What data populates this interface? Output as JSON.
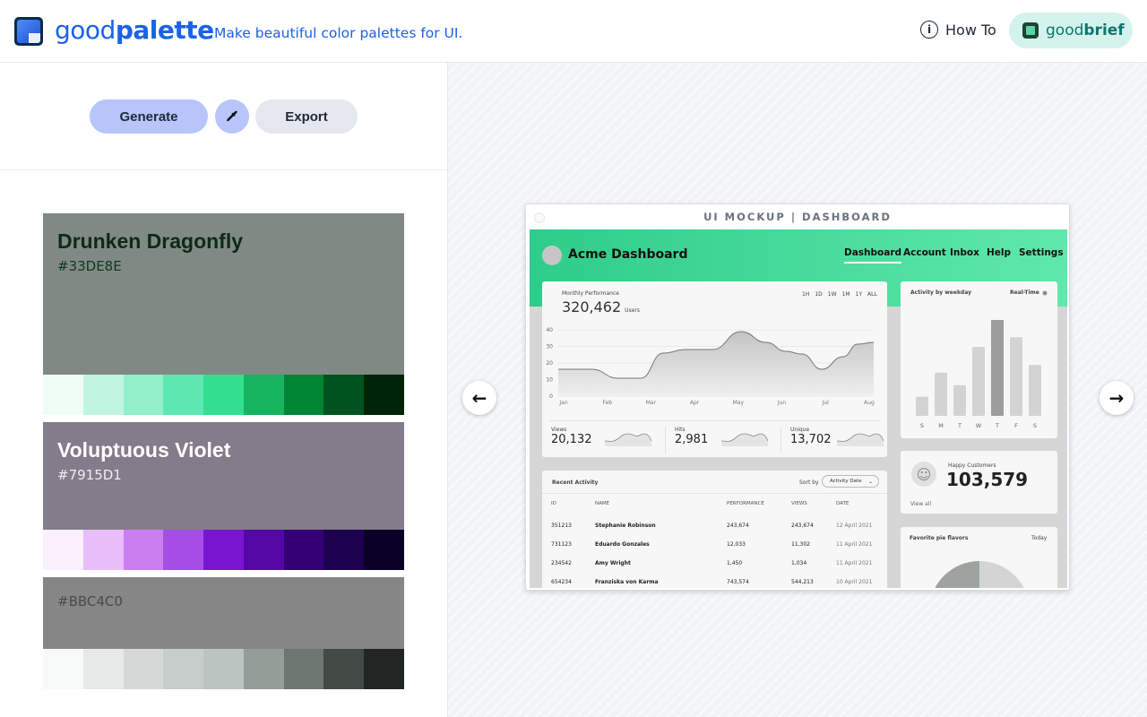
{
  "header": {
    "brand_light": "good",
    "brand_bold": "palette",
    "tagline": "Make beautiful color palettes for UI.",
    "howto_label": "How To",
    "howto_icon": "info-icon",
    "goodbrief_light": "good",
    "goodbrief_bold": "brief"
  },
  "toolbar": {
    "generate_label": "Generate",
    "picker_icon": "eyedropper-icon",
    "export_label": "Export"
  },
  "palettes": [
    {
      "name": "Drunken Dragonfly",
      "hex": "#33DE8E",
      "main_color": "#818984",
      "text_color": "#0d2a17",
      "swatches": [
        "#f0fdf7",
        "#c2f5e1",
        "#91efca",
        "#5ce8b0",
        "#33de8e",
        "#16b45f",
        "#008535",
        "#00531e",
        "#002408"
      ]
    },
    {
      "name": "Voluptuous Violet",
      "hex": "#7915D1",
      "main_color": "#847c8a",
      "text_color": "#ffffff",
      "swatches": [
        "#fbf0fe",
        "#e9bdf9",
        "#cb7ef0",
        "#a54ee6",
        "#7915d1",
        "#5507a5",
        "#340075",
        "#1d0050",
        "#0b0027"
      ]
    },
    {
      "name": "",
      "hex": "#BBC4C0",
      "main_color": "#868686",
      "text_color": "#4a4a4a",
      "swatches": [
        "#f8faf9",
        "#e5eae8",
        "#d4d9d7",
        "#c7cdca",
        "#bbc4c0",
        "#959d99",
        "#6e7672",
        "#434945",
        "#212523"
      ]
    }
  ],
  "preview": {
    "prev_icon": "arrow-left-icon",
    "next_icon": "arrow-right-icon",
    "title": "UI MOCKUP | DASHBOARD",
    "app_name": "Acme Dashboard",
    "nav": [
      "Dashboard",
      "Account",
      "Inbox",
      "Help",
      "Settings"
    ],
    "performance": {
      "label": "Monthly Performance",
      "value": "320,462",
      "unit": "Users",
      "ranges": [
        "1H",
        "1D",
        "1W",
        "1M",
        "1Y",
        "ALL"
      ],
      "y_ticks": [
        "40",
        "30",
        "20",
        "10",
        "0"
      ],
      "months": [
        "Jan",
        "Feb",
        "Mar",
        "Apr",
        "May",
        "Jun",
        "Jul",
        "Aug"
      ]
    },
    "stats": [
      {
        "label": "Views",
        "value": "20,132"
      },
      {
        "label": "Hits",
        "value": "2,981"
      },
      {
        "label": "Unique",
        "value": "13,702"
      }
    ],
    "weekday": {
      "title": "Activity by weekday",
      "mode": "Real-Time",
      "days": [
        "S",
        "M",
        "T",
        "W",
        "T",
        "F",
        "S"
      ],
      "levels": [
        0.2,
        0.45,
        0.32,
        0.72,
        1.0,
        0.82,
        0.53
      ]
    },
    "customers": {
      "label": "Happy Customers",
      "value": "103,579",
      "link": "View all"
    },
    "pie": {
      "title": "Favorite pie flavors",
      "period": "Today"
    },
    "activity": {
      "title": "Recent Activity",
      "sort_label": "Sort by",
      "sort_value": "Activity Date",
      "columns": [
        "ID",
        "NAME",
        "PERFORMANCE",
        "VIEWS",
        "DATE"
      ],
      "rows": [
        [
          "351213",
          "Stephanie Robinson",
          "243,674",
          "243,674",
          "12 April 2021"
        ],
        [
          "731123",
          "Eduardo Gonzales",
          "12,033",
          "11,302",
          "11 April 2021"
        ],
        [
          "234542",
          "Amy Wright",
          "1,450",
          "1,034",
          "11 April 2021"
        ],
        [
          "654234",
          "Franziska von Karma",
          "743,574",
          "544,213",
          "10 April 2021"
        ]
      ]
    }
  }
}
